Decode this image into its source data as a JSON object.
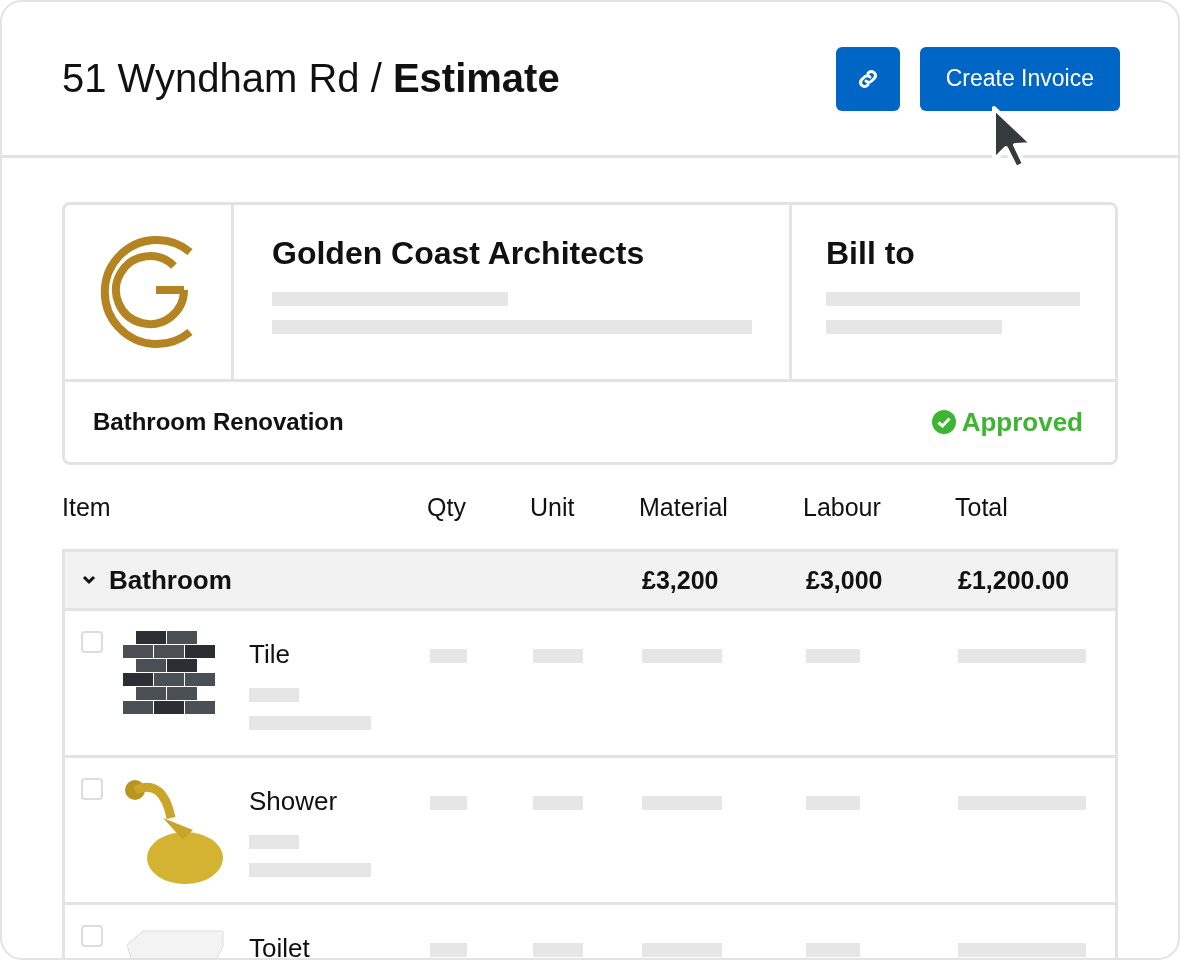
{
  "header": {
    "address": "51 Wyndham Rd",
    "separator": "/",
    "title": "Estimate",
    "create_button": "Create Invoice"
  },
  "estimate": {
    "company": "Golden Coast Architects",
    "bill_to": "Bill to",
    "project": "Bathroom Renovation",
    "status": "Approved"
  },
  "table": {
    "columns": [
      "Item",
      "Qty",
      "Unit",
      "Material",
      "Labour",
      "Total"
    ],
    "group": {
      "name": "Bathroom",
      "expanded": true,
      "material": "£3,200",
      "labour": "£3,000",
      "total": "£1,200.00"
    },
    "rows": [
      {
        "name": "Tile",
        "checked": false
      },
      {
        "name": "Shower",
        "checked": false
      },
      {
        "name": "Toilet",
        "checked": false
      }
    ]
  }
}
